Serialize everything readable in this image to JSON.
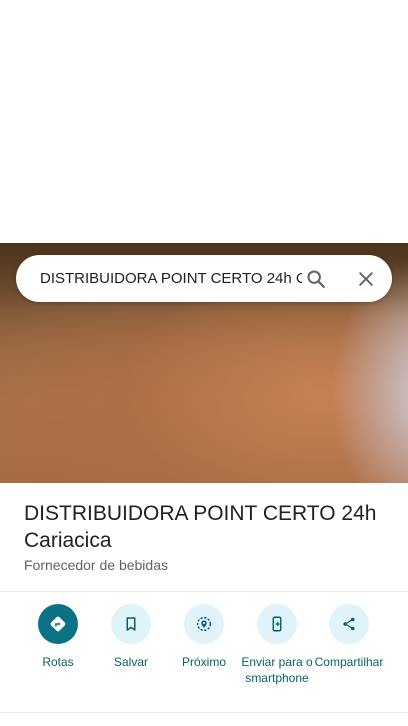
{
  "search": {
    "query": "DISTRIBUIDORA POINT CERTO 24h C",
    "search_icon": "search-icon",
    "clear_icon": "close-icon"
  },
  "place": {
    "name": "DISTRIBUIDORA POINT CERTO 24h Cariacica",
    "category": "Fornecedor de bebidas"
  },
  "actions": [
    {
      "label": "Rotas",
      "icon": "directions-icon"
    },
    {
      "label": "Salvar",
      "icon": "bookmark-icon"
    },
    {
      "label": "Próximo",
      "icon": "nearby-icon"
    },
    {
      "label": "Enviar para o smartphone",
      "icon": "send-to-phone-icon"
    },
    {
      "label": "Compartilhar",
      "icon": "share-icon"
    }
  ],
  "colors": {
    "accent": "#0b7285",
    "action_bg": "#dff3f8",
    "action_text": "#0b5f6b"
  }
}
